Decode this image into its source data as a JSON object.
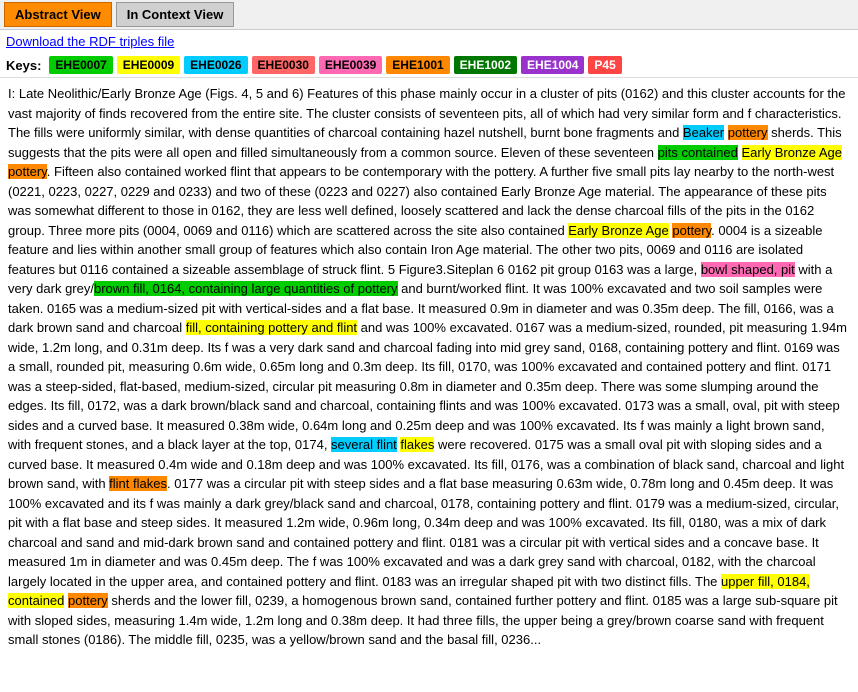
{
  "tabs": [
    {
      "label": "Abstract View",
      "active": true
    },
    {
      "label": "In Context View",
      "active": false
    }
  ],
  "download_link": "Download the RDF triples file",
  "keys": {
    "label": "Keys:",
    "items": [
      {
        "id": "EHE0007",
        "color": "#00cc00",
        "text_color": "#000"
      },
      {
        "id": "EHE0009",
        "color": "#ffff00",
        "text_color": "#000"
      },
      {
        "id": "EHE0026",
        "color": "#00ccff",
        "text_color": "#000"
      },
      {
        "id": "EHE0030",
        "color": "#ff6666",
        "text_color": "#000"
      },
      {
        "id": "EHE0039",
        "color": "#ff69b4",
        "text_color": "#000"
      },
      {
        "id": "EHE1001",
        "color": "#ff8800",
        "text_color": "#000"
      },
      {
        "id": "EHE1002",
        "color": "#007700",
        "text_color": "#fff"
      },
      {
        "id": "EHE1004",
        "color": "#9933cc",
        "text_color": "#fff"
      },
      {
        "id": "P45",
        "color": "#ff4444",
        "text_color": "#fff"
      }
    ]
  }
}
